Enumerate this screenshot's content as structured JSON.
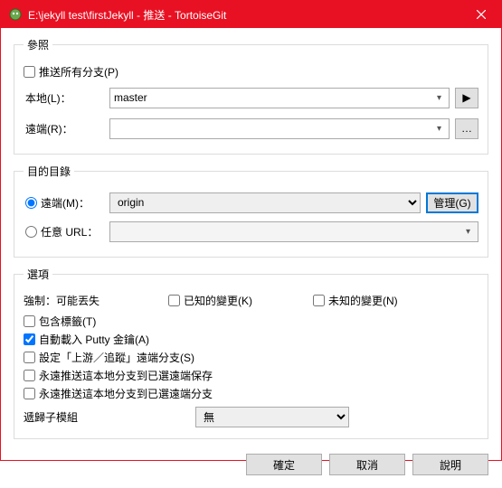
{
  "window": {
    "title": "E:\\jekyll test\\firstJekyll - 推送 - TortoiseGit"
  },
  "ref_group": {
    "legend": "參照",
    "push_all": "推送所有分支(P)",
    "local_label": "本地(L)：",
    "local_value": "master",
    "remote_label": "遠端(R)：",
    "remote_value": ""
  },
  "dest_group": {
    "legend": "目的目錄",
    "remote_radio": "遠端(M)：",
    "remote_value": "origin",
    "manage_btn": "管理(G)",
    "url_radio": "任意 URL：",
    "url_value": ""
  },
  "opt_group": {
    "legend": "選項",
    "force_label": "強制：可能丟失",
    "known_changes": "已知的變更(K)",
    "unknown_changes": "未知的變更(N)",
    "include_tags": "包含標籤(T)",
    "autoload_putty": "自動載入 Putty 金鑰(A)",
    "set_upstream": "設定「上游／追蹤」遠端分支(S)",
    "always_push_save": "永遠推送這本地分支到已選遠端保存",
    "always_push_branch": "永遠推送這本地分支到已選遠端分支",
    "recurse_label": "遞歸子模組",
    "recurse_value": "無"
  },
  "buttons": {
    "ok": "確定",
    "cancel": "取消",
    "help": "說明"
  }
}
